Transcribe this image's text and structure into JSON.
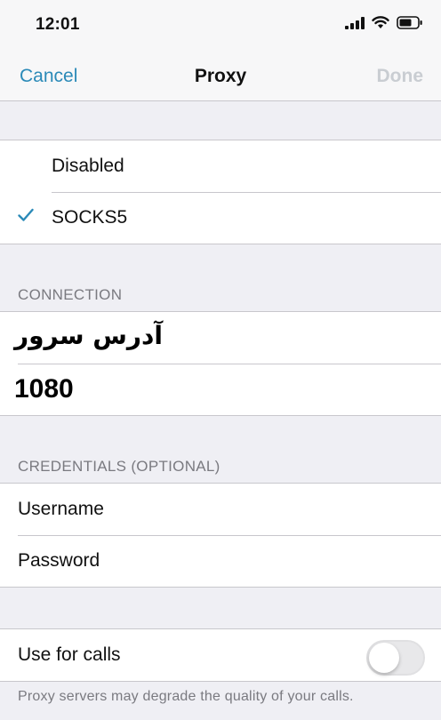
{
  "status_bar": {
    "time": "12:01",
    "icons": [
      "signal-icon",
      "wifi-icon",
      "battery-icon"
    ]
  },
  "nav": {
    "cancel_label": "Cancel",
    "title": "Proxy",
    "done_label": "Done"
  },
  "proxy_types": {
    "options": [
      {
        "label": "Disabled",
        "selected": false
      },
      {
        "label": "SOCKS5",
        "selected": true
      }
    ]
  },
  "connection": {
    "header": "CONNECTION",
    "server_value": "آدرس سرور",
    "port_value": "1080"
  },
  "credentials": {
    "header": "CREDENTIALS (OPTIONAL)",
    "username_placeholder": "Username",
    "password_placeholder": "Password"
  },
  "calls": {
    "label": "Use for calls",
    "enabled": false,
    "note": "Proxy servers may degrade the quality of your calls."
  },
  "colors": {
    "accent": "#2b8ab8",
    "done_disabled": "#c9cdd2",
    "background": "#efeff4"
  }
}
